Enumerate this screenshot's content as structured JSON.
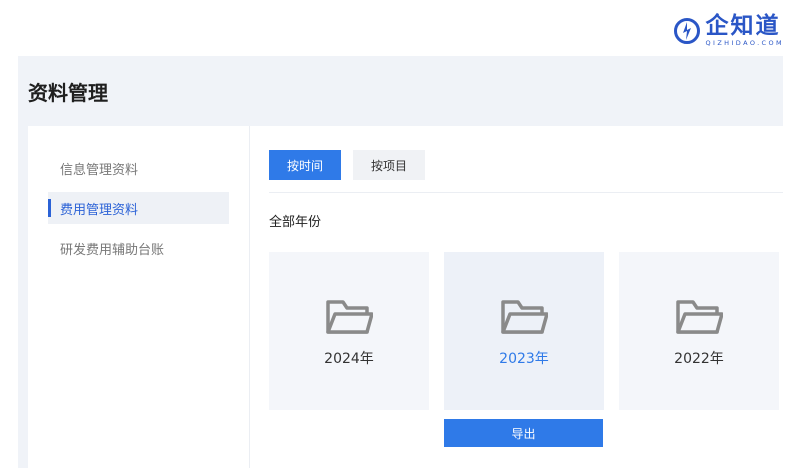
{
  "logo": {
    "name": "企知道",
    "sub": "QIZHIDAO.COM",
    "color": "#2a56c6"
  },
  "page": {
    "title": "资料管理"
  },
  "sidebar": {
    "items": [
      {
        "label": "信息管理资料",
        "active": false
      },
      {
        "label": "费用管理资料",
        "active": true
      },
      {
        "label": "研发费用辅助台账",
        "active": false
      }
    ]
  },
  "tabs": [
    {
      "label": "按时间",
      "active": true
    },
    {
      "label": "按项目",
      "active": false
    }
  ],
  "section": {
    "label": "全部年份"
  },
  "folders": [
    {
      "label": "2024年",
      "icon": "folder-icon",
      "selected": false
    },
    {
      "label": "2023年",
      "icon": "folder-icon",
      "selected": true
    },
    {
      "label": "2022年",
      "icon": "folder-icon",
      "selected": false
    }
  ],
  "export": {
    "label": "导出"
  },
  "colors": {
    "accent": "#2f7ae8",
    "panel_bg": "#f0f3f8"
  }
}
